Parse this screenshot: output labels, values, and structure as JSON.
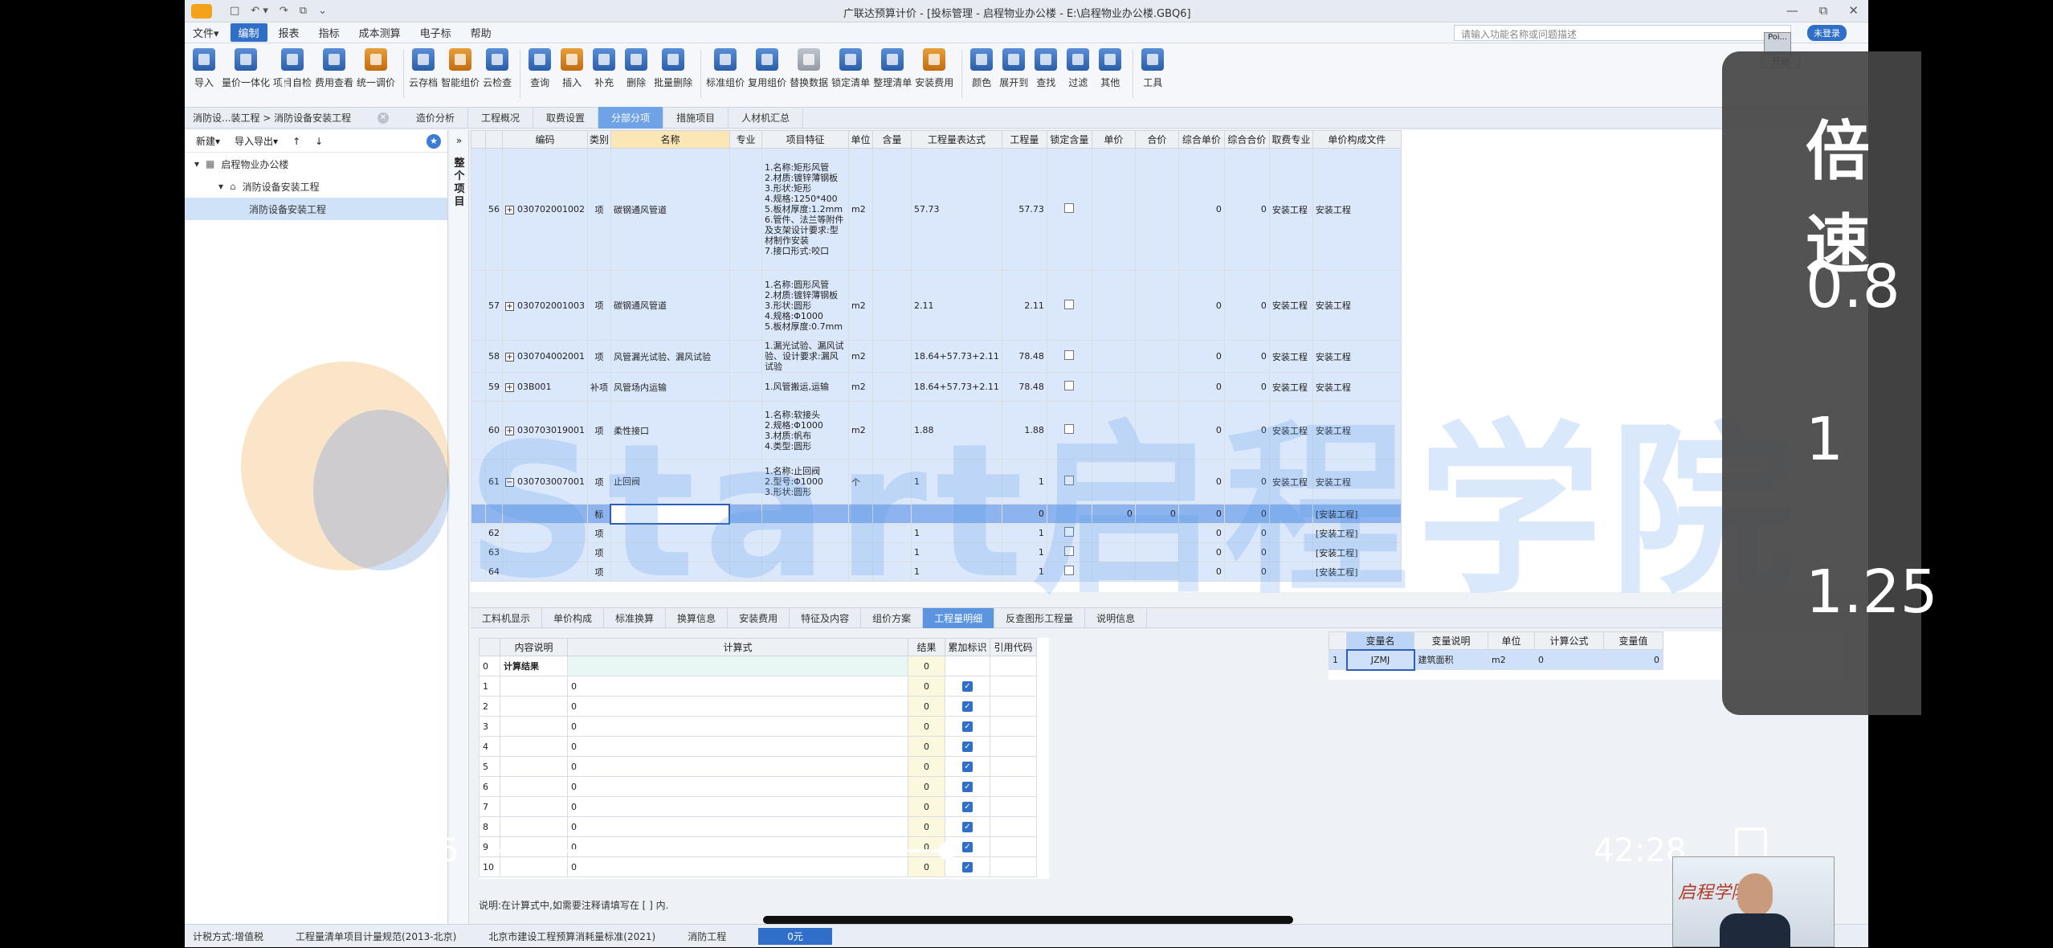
{
  "window": {
    "title": "广联达预算计价 - [投标管理 - 启程物业办公楼 - E:\\启程物业办公楼.GBQ6]",
    "quick_access": [
      "□",
      "↶ ▾",
      "↷",
      "⧉",
      "⌄"
    ],
    "controls": [
      "—",
      "⧉",
      "✕"
    ]
  },
  "menu": {
    "items": [
      "文件▾",
      "编制",
      "报表",
      "指标",
      "成本测算",
      "电子标",
      "帮助"
    ],
    "active_index": 1,
    "search_placeholder": "请输入功能名称或问题描述",
    "login_badge": "未登录"
  },
  "toolbar": {
    "buttons": [
      {
        "label": "导入",
        "style": "blue"
      },
      {
        "label": "量价一体化",
        "style": "blue"
      },
      {
        "label": "项目自检",
        "style": "blue"
      },
      {
        "label": "费用查看",
        "style": "blue"
      },
      {
        "label": "统一调价",
        "style": "alt"
      },
      {
        "label": "云存档",
        "style": "blue"
      },
      {
        "label": "智能组价",
        "style": "alt"
      },
      {
        "label": "云检查",
        "style": "blue"
      },
      {
        "label": "查询",
        "style": "blue"
      },
      {
        "label": "插入",
        "style": "alt"
      },
      {
        "label": "补充",
        "style": "blue"
      },
      {
        "label": "删除",
        "style": "blue"
      },
      {
        "label": "批量删除",
        "style": "blue"
      },
      {
        "label": "标准组价",
        "style": "blue"
      },
      {
        "label": "复用组价",
        "style": "blue"
      },
      {
        "label": "替换数据",
        "style": "gry"
      },
      {
        "label": "锁定清单",
        "style": "blue"
      },
      {
        "label": "整理清单",
        "style": "blue"
      },
      {
        "label": "安装费用",
        "style": "alt"
      },
      {
        "label": "颜色",
        "style": "blue"
      },
      {
        "label": "展开到",
        "style": "blue"
      },
      {
        "label": "查找",
        "style": "blue"
      },
      {
        "label": "过滤",
        "style": "blue"
      },
      {
        "label": "其他",
        "style": "blue"
      },
      {
        "label": "工具",
        "style": "blue"
      }
    ]
  },
  "tabs": {
    "breadcrumb": "消防设...装工程 > 消防设备安装工程",
    "items": [
      "造价分析",
      "工程概况",
      "取费设置",
      "分部分项",
      "措施项目",
      "人材机汇总"
    ],
    "active_index": 3
  },
  "left_panel": {
    "actions": [
      "新建▾",
      "导入导出▾",
      "↑",
      "↓"
    ],
    "tree": [
      {
        "label": "启程物业办公楼",
        "level": 0,
        "selected": false
      },
      {
        "label": "消防设备安装工程",
        "level": 1,
        "selected": false
      },
      {
        "label": "消防设备安装工程",
        "level": 2,
        "selected": true
      }
    ]
  },
  "side_label": "整个项目",
  "grid": {
    "columns": [
      "",
      "编码",
      "类别",
      "名称",
      "专业",
      "项目特征",
      "单位",
      "含量",
      "工程量表达式",
      "工程量",
      "锁定含量",
      "单价",
      "合价",
      "综合单价",
      "综合合价",
      "取费专业",
      "单价构成文件"
    ],
    "rows": [
      {
        "num": "56",
        "code": "030702001002",
        "type": "项",
        "name": "碳钢通风管道",
        "spec": "",
        "feature": "1.名称:矩形风管\n2.材质:镀锌薄钢板\n3.形状:矩形\n4.规格:1250*400\n5.板材厚度:1.2mm\n6.管件、法兰等附件及支架设计要求:型材制作安装\n7.接口形式:咬口",
        "unit": "m2",
        "content": "",
        "expr": "57.73",
        "qty": "57.73",
        "lock": true,
        "price": "",
        "total": "",
        "comp_price": "0",
        "comp_total": "0",
        "fee": "安装工程",
        "file": "安装工程",
        "h": 152,
        "style": ""
      },
      {
        "num": "57",
        "code": "030702001003",
        "type": "项",
        "name": "碳钢通风管道",
        "spec": "",
        "feature": "1.名称:圆形风管\n2.材质:镀锌薄钢板\n3.形状:圆形\n4.规格:Φ1000\n5.板材厚度:0.7mm",
        "unit": "m2",
        "content": "",
        "expr": "2.11",
        "qty": "2.11",
        "lock": true,
        "price": "",
        "total": "",
        "comp_price": "0",
        "comp_total": "0",
        "fee": "安装工程",
        "file": "安装工程",
        "h": 87,
        "style": ""
      },
      {
        "num": "58",
        "code": "030704002001",
        "type": "项",
        "name": "风管漏光试验、漏风试验",
        "spec": "",
        "feature": "1.漏光试验、漏风试验、设计要求:漏风试验",
        "unit": "m2",
        "content": "",
        "expr": "18.64+57.73+2.11",
        "qty": "78.48",
        "lock": true,
        "price": "",
        "total": "",
        "comp_price": "0",
        "comp_total": "0",
        "fee": "安装工程",
        "file": "安装工程",
        "h": 36,
        "style": ""
      },
      {
        "num": "59",
        "code": "03B001",
        "type": "补项",
        "name": "风管场内运输",
        "spec": "",
        "feature": "1.风管搬运,运输",
        "unit": "m2",
        "content": "",
        "expr": "18.64+57.73+2.11",
        "qty": "78.48",
        "lock": true,
        "price": "",
        "total": "",
        "comp_price": "0",
        "comp_total": "0",
        "fee": "安装工程",
        "file": "安装工程",
        "h": 36,
        "style": ""
      },
      {
        "num": "60",
        "code": "030703019001",
        "type": "项",
        "name": "柔性接口",
        "spec": "",
        "feature": "1.名称:软接头\n2.规格:Φ1000\n3.材质:帆布\n4.类型:圆形",
        "unit": "m2",
        "content": "",
        "expr": "1.88",
        "qty": "1.88",
        "lock": true,
        "price": "",
        "total": "",
        "comp_price": "0",
        "comp_total": "0",
        "fee": "安装工程",
        "file": "安装工程",
        "h": 72,
        "style": ""
      },
      {
        "num": "61",
        "code": "030703007001",
        "type": "项",
        "name": "止回阀",
        "spec": "",
        "feature": "1.名称:止回阀\n2.型号:Φ1000\n3.形状:圆形",
        "unit": "个",
        "content": "",
        "expr": "1",
        "qty": "1",
        "lock": true,
        "price": "",
        "total": "",
        "comp_price": "0",
        "comp_total": "0",
        "fee": "安装工程",
        "file": "安装工程",
        "h": 56,
        "style": ""
      },
      {
        "num": "",
        "code": "",
        "type": "标",
        "name": "",
        "spec": "",
        "feature": "",
        "unit": "",
        "content": "",
        "expr": "",
        "qty": "0",
        "lock": false,
        "price": "0",
        "total": "0",
        "comp_price": "0",
        "comp_total": "0",
        "fee": "",
        "file": "[安装工程]",
        "h": 24,
        "style": "hl"
      },
      {
        "num": "62",
        "code": "",
        "type": "项",
        "name": "",
        "spec": "",
        "feature": "",
        "unit": "",
        "content": "",
        "expr": "1",
        "qty": "1",
        "lock": true,
        "price": "",
        "total": "",
        "comp_price": "0",
        "comp_total": "0",
        "fee": "",
        "file": "[安装工程]",
        "h": 24,
        "style": ""
      },
      {
        "num": "63",
        "code": "",
        "type": "项",
        "name": "",
        "spec": "",
        "feature": "",
        "unit": "",
        "content": "",
        "expr": "1",
        "qty": "1",
        "lock": true,
        "price": "",
        "total": "",
        "comp_price": "0",
        "comp_total": "0",
        "fee": "",
        "file": "[安装工程]",
        "h": 24,
        "style": ""
      },
      {
        "num": "64",
        "code": "",
        "type": "项",
        "name": "",
        "spec": "",
        "feature": "",
        "unit": "",
        "content": "",
        "expr": "1",
        "qty": "1",
        "lock": true,
        "price": "",
        "total": "",
        "comp_price": "0",
        "comp_total": "0",
        "fee": "",
        "file": "[安装工程]",
        "h": 24,
        "style": ""
      }
    ]
  },
  "bottom_tabs": {
    "items": [
      "工料机显示",
      "单价构成",
      "标准换算",
      "换算信息",
      "安装费用",
      "特征及内容",
      "组价方案",
      "工程量明细",
      "反查图形工程量",
      "说明信息"
    ],
    "active_index": 7
  },
  "formula": {
    "columns": [
      "",
      "内容说明",
      "计算式",
      "结果",
      "累加标识",
      "引用代码"
    ],
    "rows": [
      {
        "num": "0",
        "desc": "计算结果",
        "expr": "",
        "result": "0",
        "checked": false
      },
      {
        "num": "1",
        "desc": "",
        "expr": "0",
        "result": "0",
        "checked": true
      },
      {
        "num": "2",
        "desc": "",
        "expr": "0",
        "result": "0",
        "checked": true
      },
      {
        "num": "3",
        "desc": "",
        "expr": "0",
        "result": "0",
        "checked": true
      },
      {
        "num": "4",
        "desc": "",
        "expr": "0",
        "result": "0",
        "checked": true
      },
      {
        "num": "5",
        "desc": "",
        "expr": "0",
        "result": "0",
        "checked": true
      },
      {
        "num": "6",
        "desc": "",
        "expr": "0",
        "result": "0",
        "checked": true
      },
      {
        "num": "7",
        "desc": "",
        "expr": "0",
        "result": "0",
        "checked": true
      },
      {
        "num": "8",
        "desc": "",
        "expr": "0",
        "result": "0",
        "checked": true
      },
      {
        "num": "9",
        "desc": "",
        "expr": "0",
        "result": "0",
        "checked": true
      },
      {
        "num": "10",
        "desc": "",
        "expr": "0",
        "result": "0",
        "checked": true
      }
    ],
    "note": "说明:在计算式中,如需要注释请填写在 [ ] 内."
  },
  "variables": {
    "columns": [
      "",
      "变量名",
      "变量说明",
      "单位",
      "计算公式",
      "变量值"
    ],
    "rows": [
      {
        "num": "1",
        "name": "JZMJ",
        "desc": "建筑面积",
        "unit": "m2",
        "formula": "0",
        "value": "0"
      }
    ]
  },
  "status": {
    "items": [
      "计税方式:增值税",
      "工程量清单项目计量规范(2013-北京)",
      "北京市建设工程预算消耗量标准(2021)",
      "消防工程",
      "0元"
    ]
  },
  "watermark": "Start启程学院",
  "speed_panel": {
    "title": "倍速",
    "options": [
      "0.8",
      "1",
      "1.25"
    ]
  },
  "player": {
    "elapsed": "17:56",
    "total": "42:28",
    "progress": 0.42
  },
  "mini_window": {
    "title": "Poi...",
    "button": "开始"
  },
  "camera": {
    "signature": "启程学院"
  }
}
